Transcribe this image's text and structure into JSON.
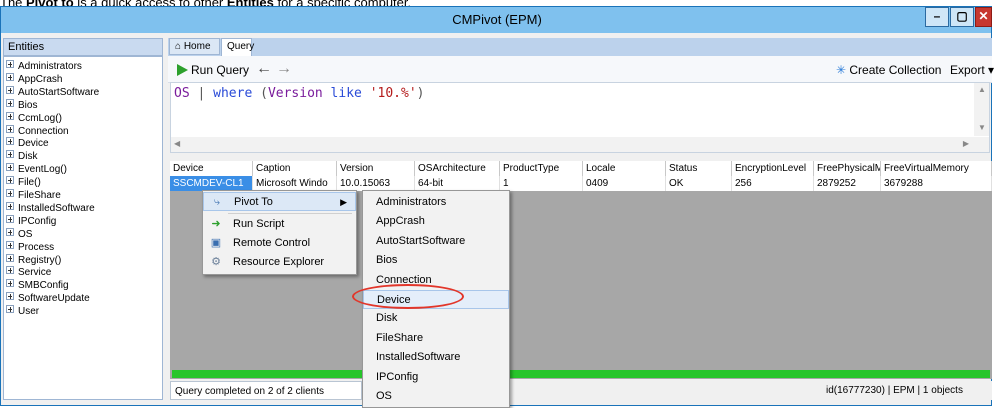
{
  "caption": {
    "prefix": "The ",
    "bold1": "Pivot to",
    "middle": " is a quick access to other ",
    "bold2": "Entities",
    "suffix": " for a specific computer."
  },
  "window": {
    "title": "CMPivot (EPM)",
    "min_glyph": "–",
    "max_glyph": "▢",
    "close_glyph": "✕"
  },
  "entities": {
    "header": "Entities",
    "items": [
      "Administrators",
      "AppCrash",
      "AutoStartSoftware",
      "Bios",
      "CcmLog()",
      "Connection",
      "Device",
      "Disk",
      "EventLog()",
      "File()",
      "FileShare",
      "InstalledSoftware",
      "IPConfig",
      "OS",
      "Process",
      "Registry()",
      "Service",
      "SMBConfig",
      "SoftwareUpdate",
      "User"
    ]
  },
  "tabs": {
    "home": "Home",
    "query": "Query"
  },
  "toolbar": {
    "run_query": "Run Query",
    "back": "←",
    "forward": "→",
    "create_collection": "Create Collection",
    "export": "Export ▾"
  },
  "query": {
    "entity": "OS",
    "pipe": " | ",
    "where": "where",
    "open": " (",
    "field": "Version",
    "like": " like ",
    "literal": "'10.%'",
    "close": ")"
  },
  "grid": {
    "columns": [
      "Device",
      "Caption",
      "Version",
      "OSArchitecture",
      "ProductType",
      "Locale",
      "Status",
      "EncryptionLevel",
      "FreePhysicalMemc",
      "FreeVirtualMemory"
    ],
    "row": [
      "SSCMDEV-CL1",
      "Microsoft Windo",
      "10.0.15063",
      "64-bit",
      "1",
      "0409",
      "OK",
      "256",
      "2879252",
      "3679288"
    ]
  },
  "context_menu": {
    "pivot_to": "Pivot To",
    "items": [
      "Run Script",
      "Remote Control",
      "Resource Explorer"
    ]
  },
  "submenu": {
    "items": [
      "Administrators",
      "AppCrash",
      "AutoStartSoftware",
      "Bios",
      "Connection",
      "Device",
      "Disk",
      "FileShare",
      "InstalledSoftware",
      "IPConfig",
      "OS"
    ],
    "highlighted": "Device"
  },
  "status": {
    "left": "Query completed on 2 of 2 clients",
    "right": "id(16777230)  |  EPM  |  1 objects"
  },
  "colors": {
    "titlebar": "#7fc1ee",
    "selection": "#3a8ee6",
    "progress": "#27c52b",
    "highlight_ring": "#e2362a"
  }
}
